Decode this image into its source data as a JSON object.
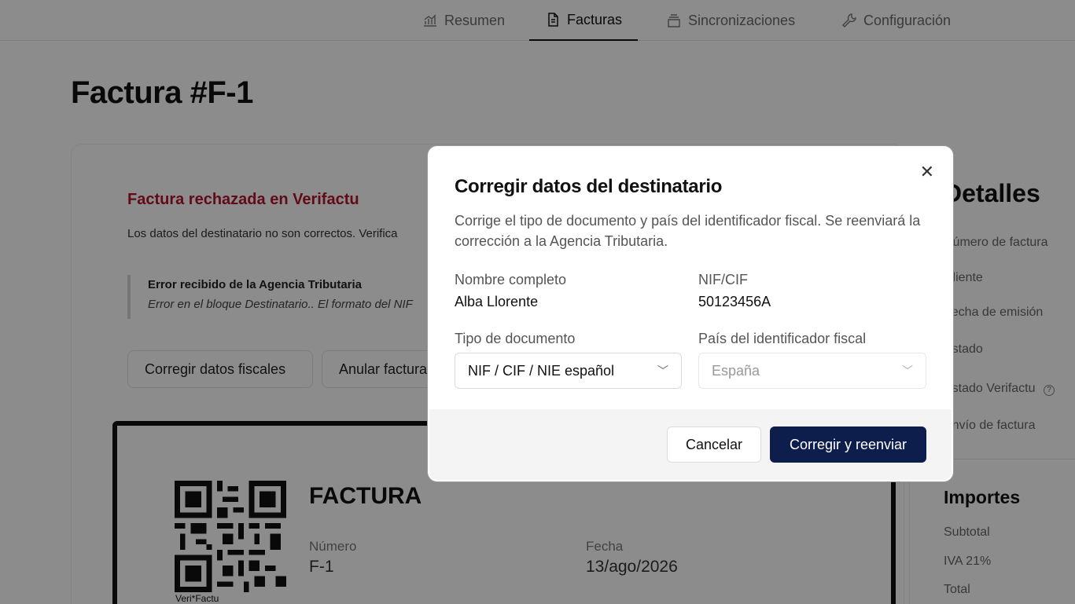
{
  "nav": {
    "tabs": [
      {
        "label": "Resumen",
        "icon": "chart-icon"
      },
      {
        "label": "Facturas",
        "icon": "document-icon",
        "active": true
      },
      {
        "label": "Sincronizaciones",
        "icon": "stack-icon"
      },
      {
        "label": "Configuración",
        "icon": "wrench-icon"
      }
    ]
  },
  "page": {
    "title": "Factura #F-1"
  },
  "alert": {
    "title": "Factura rechazada en Verifactu",
    "text": "Los datos del destinatario no son correctos. Verifica",
    "quote_title": "Error recibido de la Agencia Tributaria",
    "quote_text": "Error en el bloque Destinatario.. El formato del NIF"
  },
  "actions": {
    "fix": "Corregir datos fiscales",
    "cancel_invoice": "Anular factura"
  },
  "invoice": {
    "heading": "FACTURA",
    "number_label": "Número",
    "number_value": "F-1",
    "date_label": "Fecha",
    "date_value": "13/ago/2026",
    "qr_caption": "Veri*Factu"
  },
  "details": {
    "title": "Detalles",
    "items": [
      "Número de factura",
      "Cliente",
      "Fecha de emisión",
      "Estado",
      "Estado Verifactu",
      "Envío de factura"
    ],
    "amounts_title": "Importes",
    "amounts": [
      "Subtotal",
      "IVA 21%",
      "Total"
    ]
  },
  "modal": {
    "title": "Corregir datos del destinatario",
    "description": "Corrige el tipo de documento y país del identificador fiscal. Se reenviará la corrección a la Agencia Tributaria.",
    "name_label": "Nombre completo",
    "name_value": "Alba Llorente",
    "nif_label": "NIF/CIF",
    "nif_value": "50123456A",
    "doc_type_label": "Tipo de documento",
    "doc_type_value": "NIF / CIF / NIE español",
    "country_label": "País del identificador fiscal",
    "country_value": "España",
    "cancel": "Cancelar",
    "submit": "Corregir y reenviar"
  },
  "colors": {
    "primary": "#0d1e4c",
    "error": "#b1142c"
  }
}
